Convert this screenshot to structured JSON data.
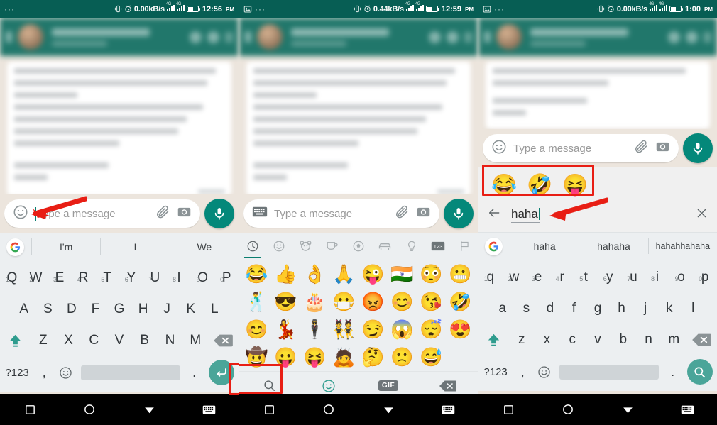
{
  "panels": [
    {
      "id": "panel-1",
      "statusbar": {
        "left_dots": "···",
        "has_photo_icon": false,
        "network_speed": "0.00kB/s",
        "sim1_label": "4G",
        "sim2_label": "4G",
        "time": "12:56",
        "meridiem": "PM"
      },
      "input": {
        "left_icon": "emoji-smiley-icon",
        "placeholder": "Type a message",
        "attach_icon": "paperclip-icon",
        "camera_icon": "camera-icon",
        "mic_icon": "microphone-icon",
        "has_caret": true
      },
      "suggestions": [
        "I'm",
        "I",
        "We"
      ],
      "keyboard": {
        "type": "qwerty-uppercase",
        "row1": [
          "Q",
          "W",
          "E",
          "R",
          "T",
          "Y",
          "U",
          "I",
          "O",
          "P"
        ],
        "row1_nums": [
          "1",
          "2",
          "3",
          "4",
          "5",
          "6",
          "7",
          "8",
          "9",
          "0"
        ],
        "row2": [
          "A",
          "S",
          "D",
          "F",
          "G",
          "H",
          "J",
          "K",
          "L"
        ],
        "row3": [
          "Z",
          "X",
          "C",
          "V",
          "B",
          "N",
          "M"
        ],
        "num_key": "?123",
        "comma_key": ",",
        "period_key": ".",
        "emoji_key_icon": "emoji-smiley-icon",
        "shift_icon": "shift-icon",
        "backspace_icon": "backspace-icon",
        "action_icon": "enter-return-icon"
      },
      "annotation": {
        "arrow": "red-arrow-pointing-to-emoji-button",
        "redbox": "enter-key-highlight"
      }
    },
    {
      "id": "panel-2",
      "statusbar": {
        "left_dots": "···",
        "has_photo_icon": true,
        "network_speed": "0.44kB/s",
        "sim1_label": "4G",
        "sim2_label": "4G",
        "time": "12:59",
        "meridiem": "PM"
      },
      "input": {
        "left_icon": "keyboard-icon",
        "placeholder": "Type a message",
        "attach_icon": "paperclip-icon",
        "camera_icon": "camera-icon",
        "mic_icon": "microphone-icon",
        "has_caret": false
      },
      "emoji_keyboard": {
        "tabs": [
          {
            "name": "recent-clock-icon",
            "active": true
          },
          {
            "name": "smileys-icon",
            "active": false
          },
          {
            "name": "animals-icon",
            "active": false
          },
          {
            "name": "food-drink-icon",
            "active": false
          },
          {
            "name": "activities-ball-icon",
            "active": false
          },
          {
            "name": "travel-car-icon",
            "active": false
          },
          {
            "name": "objects-bulb-icon",
            "active": false
          },
          {
            "name": "symbols-123-icon",
            "active": false
          },
          {
            "name": "flags-icon",
            "active": false
          }
        ],
        "grid": [
          [
            "😂",
            "👍",
            "👌",
            "🙏",
            "😜",
            "🇮🇳",
            "😳",
            "😬"
          ],
          [
            "🕺",
            "😎",
            "🎂",
            "😷",
            "😡",
            "😊",
            "😘",
            "🤣"
          ],
          [
            "😊",
            "💃",
            "🕴",
            "👯",
            "😏",
            "😱",
            "😴",
            "😍"
          ],
          [
            "🤠",
            "😛",
            "😝",
            "🙇",
            "🤔",
            "🙁",
            "😅"
          ]
        ],
        "bottom": {
          "search_icon": "emoji-search-icon",
          "emoji_icon": "emoji-smiley-icon",
          "gif_label": "GIF",
          "backspace_icon": "backspace-icon"
        }
      },
      "annotation": {
        "redbox": "emoji-search-button-highlight"
      }
    },
    {
      "id": "panel-3",
      "statusbar": {
        "left_dots": "···",
        "has_photo_icon": true,
        "network_speed": "0.00kB/s",
        "sim1_label": "4G",
        "sim2_label": "4G",
        "time": "1:00",
        "meridiem": "PM"
      },
      "input": {
        "left_icon": "emoji-smiley-icon",
        "placeholder": "Type a message",
        "attach_icon": "paperclip-icon",
        "camera_icon": "camera-icon",
        "mic_icon": "microphone-icon",
        "has_caret": false
      },
      "emoji_search": {
        "results": [
          "😂",
          "🤣",
          "😝"
        ],
        "back_icon": "back-arrow-icon",
        "query": "haha",
        "close_icon": "close-x-icon"
      },
      "suggestions": [
        "haha",
        "hahaha",
        "hahahhahaha"
      ],
      "keyboard": {
        "type": "qwerty-lowercase",
        "row1": [
          "q",
          "w",
          "e",
          "r",
          "t",
          "y",
          "u",
          "i",
          "o",
          "p"
        ],
        "row1_nums": [
          "1",
          "2",
          "3",
          "4",
          "5",
          "6",
          "7",
          "8",
          "9",
          "0"
        ],
        "row2": [
          "a",
          "s",
          "d",
          "f",
          "g",
          "h",
          "j",
          "k",
          "l"
        ],
        "row3": [
          "z",
          "x",
          "c",
          "v",
          "b",
          "n",
          "m"
        ],
        "num_key": "?123",
        "comma_key": ",",
        "period_key": ".",
        "emoji_key_icon": "emoji-smiley-icon",
        "shift_icon": "shift-icon",
        "backspace_icon": "backspace-icon",
        "action_icon": "search-magnifier-icon"
      },
      "annotation": {
        "redbox": "emoji-results-highlight",
        "arrow": "red-arrow-pointing-to-search-query"
      }
    }
  ],
  "navbar": {
    "items": [
      {
        "name": "recents-square-icon"
      },
      {
        "name": "home-circle-icon"
      },
      {
        "name": "back-triangle-icon"
      },
      {
        "name": "hide-keyboard-icon"
      }
    ]
  },
  "colors": {
    "whatsapp_teal": "#075e54",
    "accent_green": "#04887a",
    "chat_bg": "#ece5dd",
    "keyboard_bg": "#eceff1",
    "annotation_red": "#e81e14"
  }
}
